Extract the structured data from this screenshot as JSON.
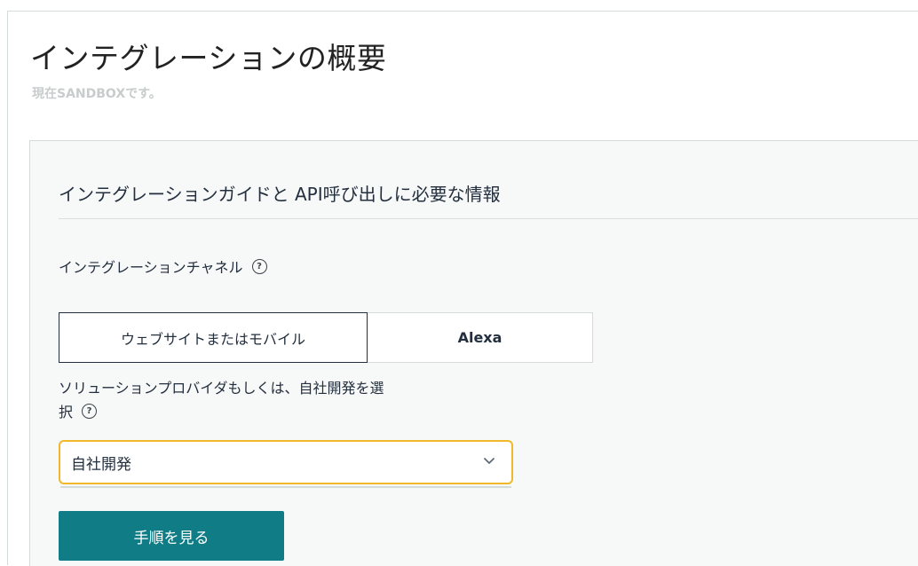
{
  "page": {
    "title": "インテグレーションの概要",
    "subtitle": "現在SANDBOXです。"
  },
  "card": {
    "title": "インテグレーションガイドと API呼び出しに必要な情報",
    "channel": {
      "label": "インテグレーションチャネル",
      "help_glyph": "?",
      "options": [
        {
          "label": "ウェブサイトまたはモバイル",
          "selected": true
        },
        {
          "label": "Alexa",
          "selected": false
        }
      ]
    },
    "provider": {
      "label_line1": "ソリューションプロバイダもしくは、自社開発を選",
      "label_line2": "択",
      "help_glyph": "?",
      "selected_value": "自社開発"
    },
    "submit_label": "手順を見る"
  },
  "colors": {
    "accent": "#0f7c86",
    "focus_ring": "#f0b82a",
    "text": "#232f3e",
    "subtle_text": "#c8cccc"
  },
  "icons": {
    "help": "question-circle-icon",
    "dropdown": "chevron-down-icon"
  }
}
